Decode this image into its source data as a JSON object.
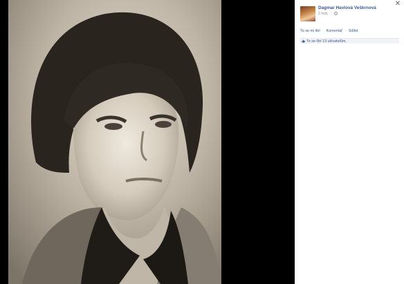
{
  "post": {
    "author": "Dagmar Havlová Veškrnová",
    "time": "2 hod.",
    "actions": {
      "like": "To se mi líbí",
      "comment": "Komentář",
      "share": "Sdílet"
    },
    "likes_text": "To se líbí 13 uživatelům."
  },
  "icons": {
    "close": "close-icon",
    "audience": "globe-icon",
    "like": "thumbs-up-icon"
  }
}
